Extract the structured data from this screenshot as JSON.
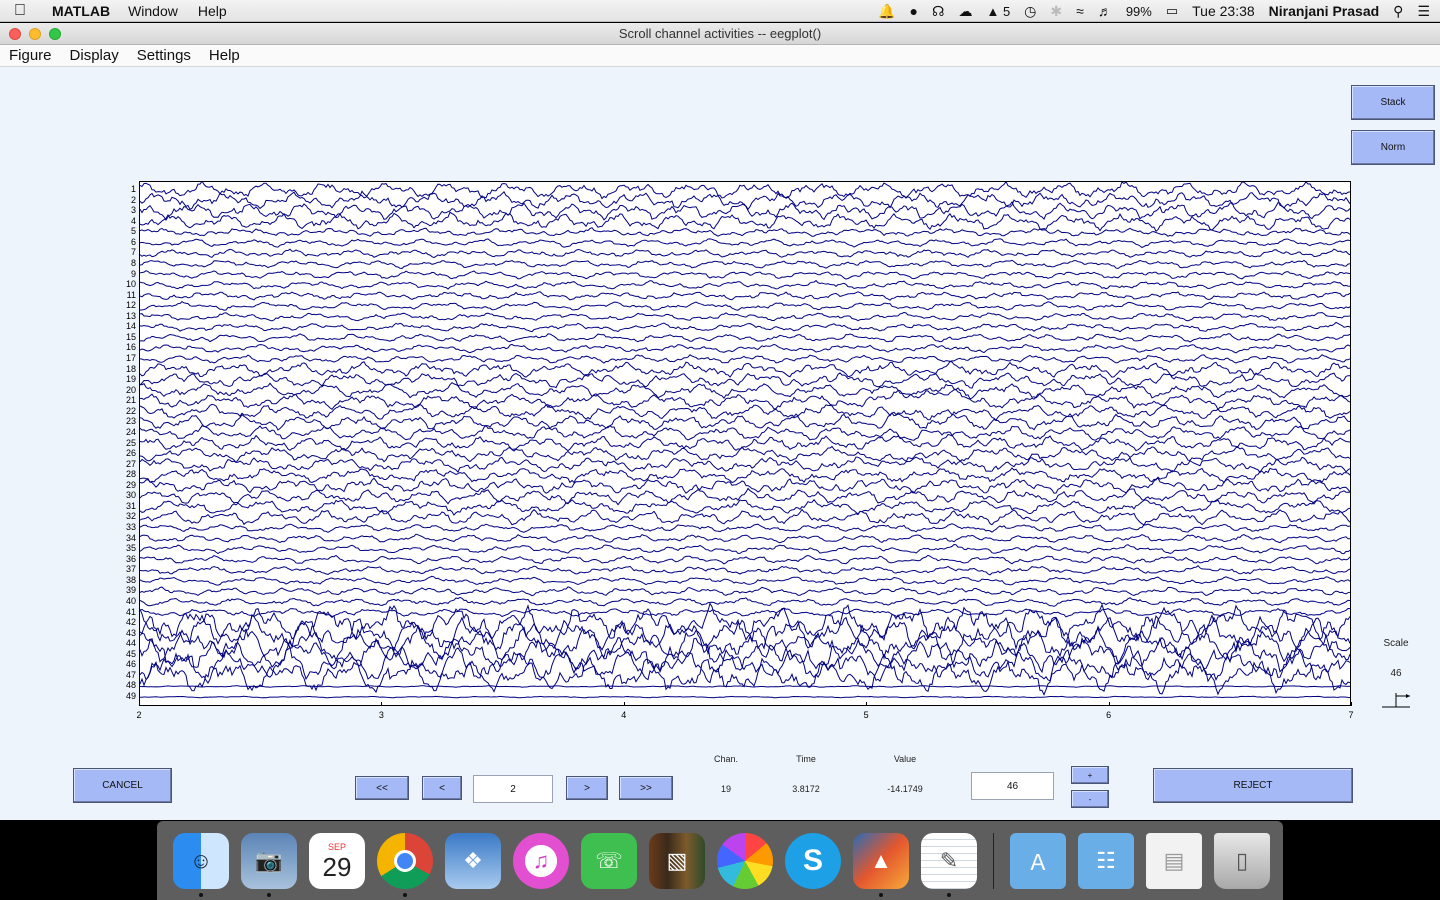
{
  "menubar": {
    "app_name": "MATLAB",
    "items": [
      "Window",
      "Help"
    ],
    "status": {
      "notifications": "5",
      "battery": "99%",
      "clock": "Tue 23:38",
      "user": "Niranjani Prasad"
    }
  },
  "window": {
    "title": "Scroll channel activities -- eegplot()",
    "menu": [
      "Figure",
      "Display",
      "Settings",
      "Help"
    ]
  },
  "controls": {
    "stack_label": "Stack",
    "norm_label": "Norm",
    "scale_label": "Scale",
    "scale_value": "46",
    "cancel_label": "CANCEL",
    "nav_first": "<<",
    "nav_prev": "<",
    "time_value": "2",
    "nav_next": ">",
    "nav_last": ">>",
    "chan_header": "Chan.",
    "time_header": "Time",
    "value_header": "Value",
    "chan_value": "19",
    "time_readout": "3.8172",
    "value_readout": "-14.1749",
    "spacing_value": "46",
    "plus_label": "+",
    "minus_label": "-",
    "reject_label": "REJECT"
  },
  "chart_data": {
    "type": "line",
    "title": "",
    "xlabel": "",
    "ylabel": "",
    "x_ticks": [
      "2",
      "3",
      "4",
      "5",
      "6",
      "7"
    ],
    "xlim": [
      2,
      7
    ],
    "channel_count": 49,
    "channel_labels": [
      "1",
      "2",
      "3",
      "4",
      "5",
      "6",
      "7",
      "8",
      "9",
      "10",
      "11",
      "12",
      "13",
      "14",
      "15",
      "16",
      "17",
      "18",
      "19",
      "20",
      "21",
      "22",
      "23",
      "24",
      "25",
      "26",
      "27",
      "28",
      "29",
      "30",
      "31",
      "32",
      "33",
      "34",
      "35",
      "36",
      "37",
      "38",
      "39",
      "40",
      "41",
      "42",
      "43",
      "44",
      "45",
      "46",
      "47",
      "48",
      "49"
    ],
    "line_color": "#000080"
  },
  "dock": {
    "calendar_month": "SEP",
    "calendar_day": "29",
    "apps": [
      "finder-icon",
      "preview-icon",
      "calendar-icon",
      "chrome-icon",
      "mail-icon",
      "itunes-icon",
      "facetime-icon",
      "books-icon",
      "photos-icon",
      "skype-icon",
      "matlab-icon",
      "textedit-icon",
      "applications-folder-icon",
      "documents-folder-icon",
      "files-icon",
      "trash-icon"
    ]
  }
}
